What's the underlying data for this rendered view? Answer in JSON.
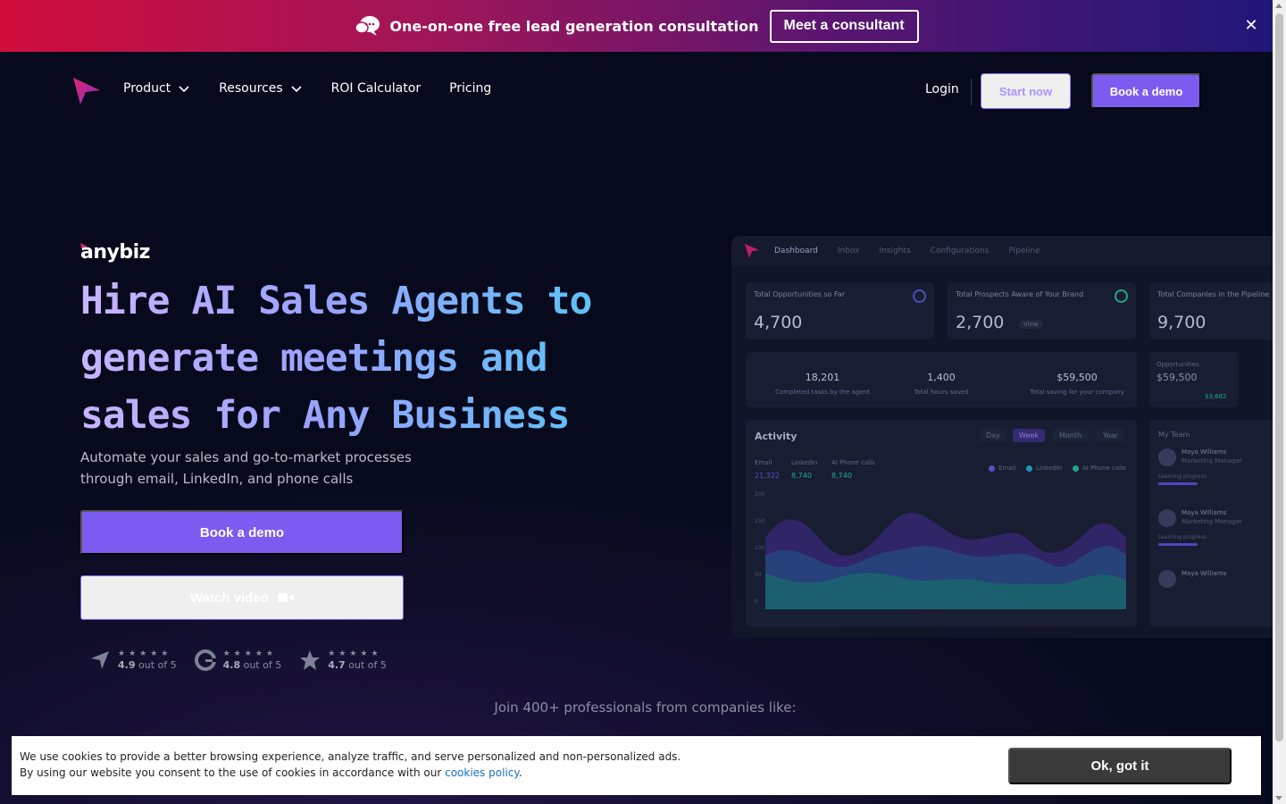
{
  "promo": {
    "text": "One-on-one free lead generation consultation",
    "button": "Meet a consultant",
    "close": "✕"
  },
  "nav": {
    "links": [
      {
        "label": "Product",
        "has_dropdown": true
      },
      {
        "label": "Resources",
        "has_dropdown": true
      },
      {
        "label": "ROI Calculator",
        "has_dropdown": false
      },
      {
        "label": "Pricing",
        "has_dropdown": false
      }
    ],
    "login": "Login",
    "start_now": "Start now",
    "book_demo": "Book a demo"
  },
  "hero": {
    "brand": "anybiz",
    "headline": "Hire AI Sales Agents to generate meetings and sales for Any Business",
    "subheadline": "Automate your sales and go-to-market processes through email, LinkedIn, and phone calls",
    "book_demo": "Book a demo",
    "watch_video": "Watch video",
    "ratings": [
      {
        "icon": "capterra-logo-icon",
        "score": "4.9",
        "suffix": "out of 5"
      },
      {
        "icon": "g2-logo-icon",
        "score": "4.8",
        "suffix": "out of 5"
      },
      {
        "icon": "star-logo-icon",
        "score": "4.7",
        "suffix": "out of 5"
      }
    ],
    "stars": "★★★★★",
    "join": "Join 400+ professionals from companies like:"
  },
  "dashboard": {
    "tabs": [
      "Dashboard",
      "Inbox",
      "Insights",
      "Configurations",
      "Pipeline"
    ],
    "cards": [
      {
        "label": "Total Opportunities so Far",
        "value": "4,700"
      },
      {
        "label": "Total Prospects Aware of Your Brand",
        "value": "2,700"
      },
      {
        "label": "Total Companies in the Pipeline",
        "value": "9,700"
      }
    ],
    "view": "View",
    "stats": [
      {
        "value": "18,201",
        "label": "Completed tasks by the agent"
      },
      {
        "value": "1,400",
        "label": "Total hours saved"
      },
      {
        "value": "$59,500",
        "label": "Total saving for your company"
      }
    ],
    "opportunities": {
      "label": "Opportunities",
      "value": "$59,500",
      "sub": "$3,682"
    },
    "activity": {
      "title": "Activity",
      "periods": [
        "Day",
        "Week",
        "Month",
        "Year"
      ],
      "active_period": "Week",
      "series": [
        {
          "name": "Email",
          "value": "21,322"
        },
        {
          "name": "LinkedIn",
          "value": "8,740"
        },
        {
          "name": "AI Phone calls",
          "value": "8,740"
        }
      ],
      "yticks": [
        "200",
        "150",
        "100",
        "50",
        "0"
      ]
    },
    "team": {
      "title": "My Team",
      "members": [
        {
          "name": "Maya Williams",
          "role": "Marketing Manager",
          "progress": "Learning progress"
        },
        {
          "name": "Maya Williams",
          "role": "Marketing Manager",
          "progress": "Learning progress"
        },
        {
          "name": "Maya Williams",
          "role": "",
          "progress": ""
        }
      ]
    },
    "colors": {
      "email": "#5b5bd6",
      "linkedin": "#1ba8c9",
      "phone": "#1fb99c"
    }
  },
  "cookie": {
    "line1": "We use cookies to provide a better browsing experience, analyze traffic, and serve personalized and non-personalized ads.",
    "line2_prefix": "By using our website you consent to the use of cookies in accordance with our",
    "link": "cookies policy",
    "line2_suffix": ".",
    "button": "Ok, got it"
  },
  "colors": {
    "accent": "#7c5cf0",
    "background": "#070a1c"
  }
}
